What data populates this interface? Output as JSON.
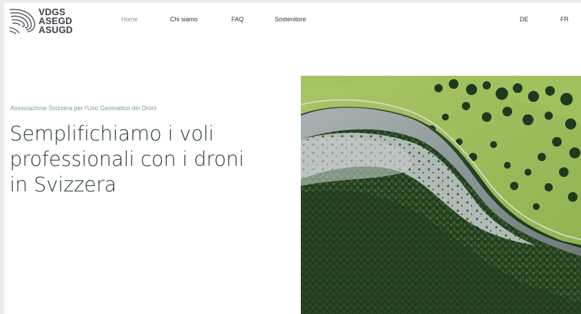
{
  "brand": {
    "line1": "VDGS",
    "line2": "ASEGD",
    "line3": "ASUGD",
    "icon": "contour-lines-logo-icon"
  },
  "nav": {
    "home": "Home",
    "about": "Chi siamo",
    "faq": "FAQ",
    "supporter": "Sostenitore",
    "lang_de": "DE",
    "lang_fr": "FR"
  },
  "hero": {
    "tagline": "Associazione Svizzera per l'Uso Geomatico dei Droni",
    "headline": [
      "Semplifichiamo i voli",
      "professionali con i droni",
      "in Svizzera"
    ],
    "image_icon": "aerial-photo-canyon-forest"
  },
  "colors": {
    "nav_active": "#8c9097",
    "text": "#2f3136",
    "tagline": "#7f9c93",
    "headline": "#2c3a3f",
    "meadow": "#9ab858",
    "forest": "#1f3a22",
    "cliff": "#8e979a"
  }
}
